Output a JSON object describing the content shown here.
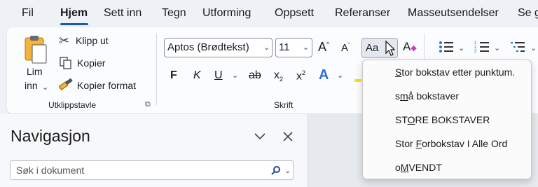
{
  "tabs": [
    "Fil",
    "Hjem",
    "Sett inn",
    "Tegn",
    "Utforming",
    "Oppsett",
    "Referanser",
    "Masseutsendelser",
    "Se g"
  ],
  "clipboard": {
    "paste_label_1": "Lim",
    "paste_label_2": "inn",
    "cut": "Klipp ut",
    "copy": "Kopier",
    "format_painter": "Kopier format",
    "group_label": "Utklippstavle"
  },
  "font": {
    "font_name": "Aptos (Brødtekst)",
    "font_size": "11",
    "change_case_label": "Aa",
    "bold": "F",
    "italic": "K",
    "underline": "U",
    "strike": "ab",
    "subscript": "x",
    "superscript": "x",
    "sub_index": "2",
    "group_label": "Skrift"
  },
  "change_case_menu": [
    {
      "pre": "",
      "key": "S",
      "post": "tor bokstav etter punktum."
    },
    {
      "pre": "s",
      "key": "m",
      "post": "å bokstaver"
    },
    {
      "pre": "ST",
      "key": "O",
      "post": "RE BOKSTAVER"
    },
    {
      "pre": "Stor ",
      "key": "F",
      "post": "orbokstav I Alle Ord"
    },
    {
      "pre": "o",
      "key": "M",
      "post": "VENDT"
    }
  ],
  "nav": {
    "title": "Navigasjon",
    "search_placeholder": "Søk i dokument"
  },
  "colors": {
    "accent": "#1f5aa6",
    "ribbon": "#fbfcfe",
    "background": "#eef1f6"
  }
}
